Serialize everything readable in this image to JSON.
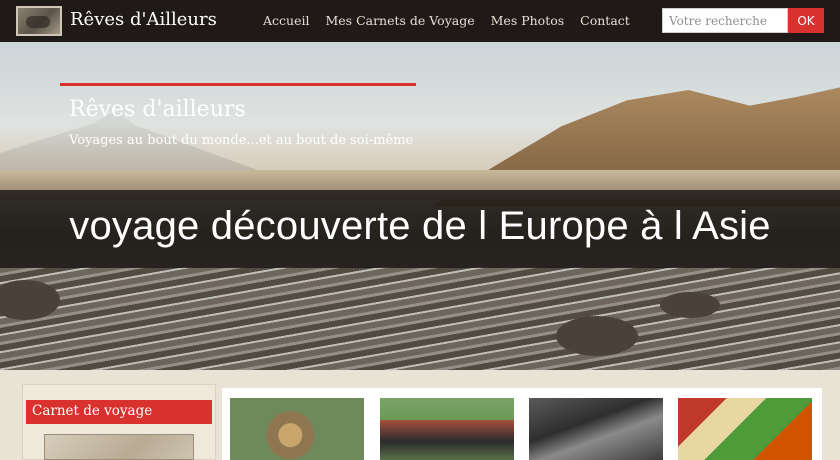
{
  "header": {
    "site_name": "Rêves d'Ailleurs",
    "nav": [
      "Accueil",
      "Mes Carnets de Voyage",
      "Mes Photos",
      "Contact"
    ],
    "search_placeholder": "Votre recherche",
    "search_button": "OK"
  },
  "hero": {
    "title": "Rêves d'ailleurs",
    "subtitle": "Voyages au bout du monde...et au bout de soi-même",
    "banner": "voyage découverte de l Europe à l Asie"
  },
  "sidebar": {
    "heading": "Carnet de voyage"
  },
  "colors": {
    "accent": "#d9312e",
    "topbar": "#1f1a17"
  }
}
